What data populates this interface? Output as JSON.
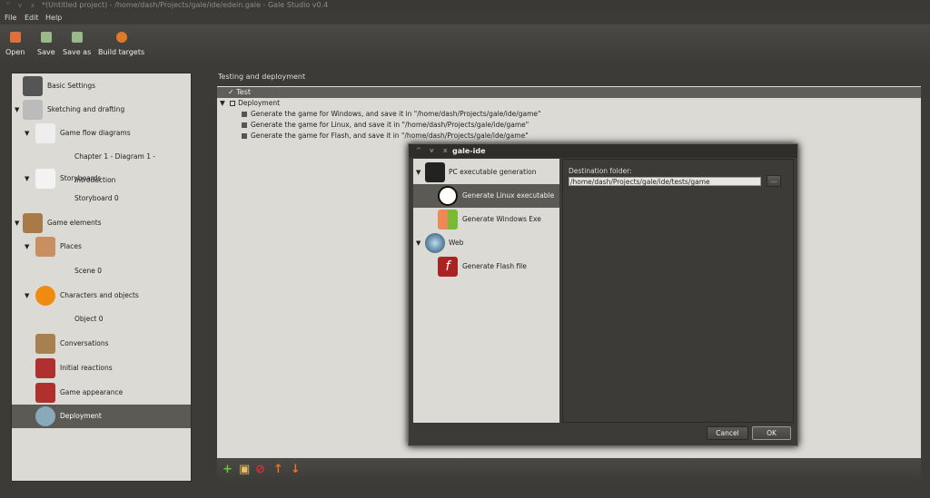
{
  "window": {
    "title": "*(Untitled project) - /home/dash/Projects/gale/ide/edein.gale - Gale Studio v0.4"
  },
  "menu": [
    "File",
    "Edit",
    "Help"
  ],
  "toolbar": [
    {
      "label": "Open",
      "icon": "open-icon"
    },
    {
      "label": "Save",
      "icon": "save-icon"
    },
    {
      "label": "Save as",
      "icon": "save-as-icon"
    },
    {
      "label": "Build targets",
      "icon": "gears-icon"
    }
  ],
  "sidebar": {
    "items": [
      {
        "label": "Basic Settings",
        "icon": "house-icon"
      },
      {
        "label": "Sketching and drafting",
        "icon": "pencil-icon"
      },
      {
        "label": "Game flow diagrams",
        "icon": "diagram-icon"
      },
      {
        "label": "Chapter 1 - Diagram 1 - Introduction"
      },
      {
        "label": "Storyboards",
        "icon": "storyboard-icon"
      },
      {
        "label": "Storyboard 0"
      },
      {
        "label": "Game elements",
        "icon": "box-icon"
      },
      {
        "label": "Places",
        "icon": "places-icon"
      },
      {
        "label": "Scene 0"
      },
      {
        "label": "Characters and objects",
        "icon": "pumpkin-icon"
      },
      {
        "label": "Object 0"
      },
      {
        "label": "Conversations",
        "icon": "conversation-icon"
      },
      {
        "label": "Initial reactions",
        "icon": "book-icon"
      },
      {
        "label": "Game appearance",
        "icon": "book-icon"
      },
      {
        "label": "Deployment",
        "icon": "globe-icon"
      }
    ]
  },
  "main": {
    "title": "Testing and deployment",
    "header": "Test",
    "tree": {
      "root": "Deployment",
      "children": [
        "Generate the game for Windows, and save it in \"/home/dash/Projects/gale/ide/game\"",
        "Generate the game for Linux, and save it in \"/home/dash/Projects/gale/ide/game\"",
        "Generate the game for Flash, and save it in \"/home/dash/Projects/gale/ide/game\""
      ]
    }
  },
  "dialog": {
    "title": "gale-ide",
    "items": [
      {
        "label": "PC executable generation",
        "icon": "monitor-icon"
      },
      {
        "label": "Generate Linux executable",
        "icon": "tux-icon"
      },
      {
        "label": "Generate Windows Exe",
        "icon": "windows-icon"
      },
      {
        "label": "Web",
        "icon": "globe-icon"
      },
      {
        "label": "Generate Flash file",
        "icon": "flash-icon"
      }
    ],
    "dest_label": "Destination folder:",
    "dest_value": "/home/dash/Projects/gale/ide/tests/game",
    "browse": "...",
    "cancel": "Cancel",
    "ok": "OK"
  },
  "colors": {
    "accent": "#5c5a55",
    "panel": "#dcdad5",
    "dark": "#3c3b37"
  }
}
